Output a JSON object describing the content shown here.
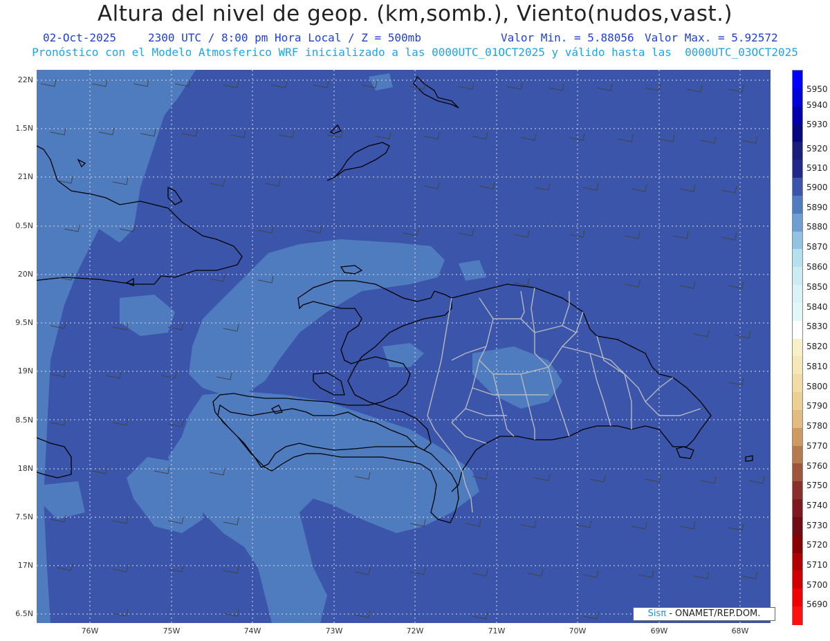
{
  "header": {
    "title": "Altura del nivel de geop. (km,somb.), Viento(nudos,vast.)",
    "date": "02-Oct-2025",
    "time": "2300 UTC / 8:00 pm Hora Local / Z = 500mb",
    "min_value": "Valor Min. = 5.88056",
    "max_value": "Valor Max. = 5.92572",
    "subtitle": "Pronóstico con el Modelo Atmosferico WRF inicializado a las 0000UTC_01OCT2025 y válido hasta las  0000UTC_03OCT2025"
  },
  "axes": {
    "lat_labels": [
      "22N",
      "1.5N",
      "21N",
      "0.5N",
      "20N",
      "9.5N",
      "19N",
      "8.5N",
      "18N",
      "7.5N",
      "17N",
      "6.5N"
    ],
    "lon_labels": [
      "76W",
      "75W",
      "74W",
      "73W",
      "72W",
      "71W",
      "70W",
      "69W",
      "68W"
    ]
  },
  "credit": {
    "sis": "Sisπ",
    "rest": "- ONAMET/REP.DOM."
  },
  "colorbar": {
    "labels": [
      "5950",
      "5940",
      "5930",
      "5920",
      "5910",
      "5900",
      "5890",
      "5880",
      "5870",
      "5860",
      "5850",
      "5840",
      "5830",
      "5820",
      "5810",
      "5800",
      "5790",
      "5780",
      "5770",
      "5760",
      "5750",
      "5740",
      "5730",
      "5720",
      "5710",
      "5700",
      "5690"
    ],
    "colors": [
      "#0000ff",
      "#0000d8",
      "#0000aa",
      "#070780",
      "#1a1e7a",
      "#22288a",
      "#3a55a9",
      "#4f7cbf",
      "#6d9fd2",
      "#93c3e3",
      "#b7e0ef",
      "#ccecf4",
      "#d9f3f7",
      "#e2f7f8",
      "#ffffff",
      "#f8f0c8",
      "#f6e8b6",
      "#f1dca4",
      "#eccf92",
      "#e2bb80",
      "#cf9a62",
      "#b77a4c",
      "#9e563a",
      "#8a2f2c",
      "#7e1820",
      "#700a14",
      "#8a0000",
      "#b00000",
      "#d00000",
      "#f00000",
      "#ff1010"
    ],
    "accent_background": "#3a55a9",
    "shade_light": "#4f7cbf"
  }
}
